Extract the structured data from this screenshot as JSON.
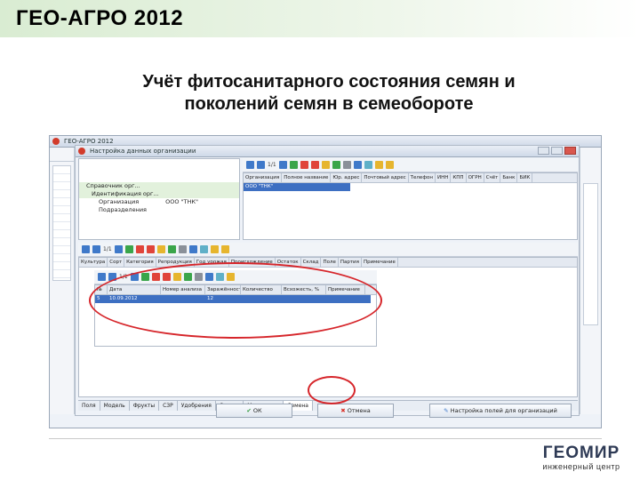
{
  "header": {
    "title": "ГЕО-АГРО 2012"
  },
  "slide": {
    "title_line1": "Учёт фитосанитарного состояния семян и",
    "title_line2": "поколений семян в семеобороте"
  },
  "app": {
    "main_window_title": "ГЕО-АГРО 2012",
    "dialog_title": "Настройка данных организации",
    "paging": "1/1",
    "tree": {
      "items": [
        "Справочник орг...",
        "Идентификация орг...",
        "Организация",
        "Подразделения"
      ],
      "value": "ООО \"ТНК\""
    },
    "upper_grid": {
      "columns": [
        "Организация",
        "Полное название",
        "Юр. адрес",
        "Почтовый адрес",
        "Телефон",
        "ИНН",
        "КПП",
        "ОГРН",
        "Счёт",
        "Банк",
        "БИК"
      ],
      "rows": [
        [
          "ООО \"ТНК\"",
          "",
          "",
          "",
          "",
          "",
          "",
          "",
          "",
          "",
          ""
        ]
      ]
    },
    "middle_grid": {
      "columns": [
        "Культура",
        "Сорт",
        "Категория",
        "Репродукция",
        "Год урожая",
        "Происхождение",
        "Остаток",
        "Склад",
        "Поле",
        "Партия",
        "Примечание"
      ]
    },
    "inner_grid": {
      "columns": [
        "№",
        "Дата",
        "Номер анализа",
        "Заражённость",
        "Количество",
        "Всхожесть, %",
        "Примечание"
      ],
      "rows": [
        [
          "5",
          "10.09.2012",
          "",
          "12",
          "",
          "",
          ""
        ]
      ]
    },
    "tabs": [
      "Поля",
      "Модель",
      "Фрукты",
      "СЗР",
      "Удобрения",
      "Ставки",
      "Материалы",
      "Семена"
    ],
    "active_tab_index": 7,
    "buttons": {
      "ok": "ОК",
      "cancel": "Отмена",
      "settings": "Настройка полей для организаций"
    }
  },
  "logo": {
    "name": "ГЕОМИР",
    "subtitle": "инженерный центр"
  },
  "colors": {
    "highlight": "#d6252a",
    "header_green": "#d9ecd2",
    "selection": "#3d6fc2"
  }
}
